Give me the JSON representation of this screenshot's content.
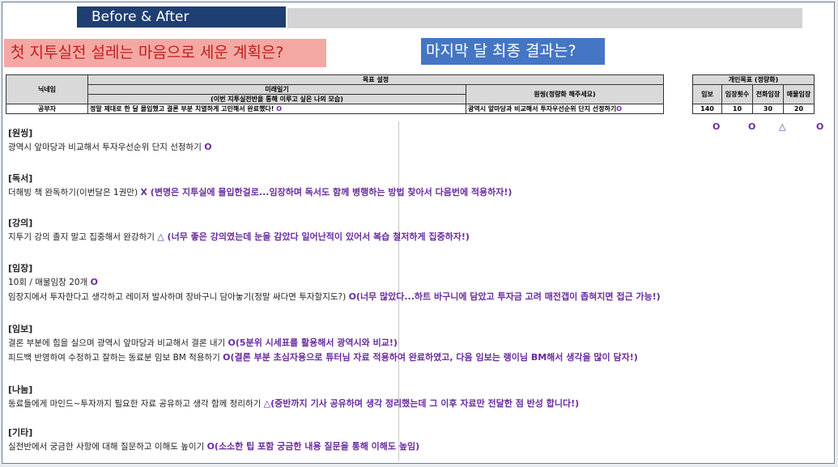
{
  "header": {
    "title": "Before & After"
  },
  "questions": {
    "plan": "첫 지투실전 설레는 마음으로 세운 계획은?",
    "result": "마지막 달 최종 결과는?"
  },
  "table": {
    "col_nickname": "닉네임",
    "col_goal": "목표 설정",
    "col_future_diary_l1": "미래일기",
    "col_future_diary_l2": "(이번 지투실전반을 통해 이루고 싶은 나의 모습)",
    "col_wish": "원씽(정량화 해주세요)",
    "col_personal": "개인목표 (정량화)",
    "sub_cols": [
      "임보",
      "임장횟수",
      "전화임장",
      "매물임장"
    ],
    "row": {
      "nickname": "공부자",
      "future_diary": "정말 제대로 한 달 몰입했고 결론 부분 치열하게 고민해서 완료했다!",
      "future_mark": "O",
      "wish": "광역시 앞마당과 비교해서 투자우선순위 단지 선정하기",
      "wish_mark": "O",
      "values": [
        "140",
        "10",
        "30",
        "20"
      ]
    },
    "result_marks": [
      "O",
      "O",
      "△",
      "O"
    ]
  },
  "sections": [
    {
      "title": "[원씽]",
      "lines": [
        {
          "text": "광역시 앞마당과 비교해서 투자우선순위 단지 선정하기",
          "note": "O"
        }
      ]
    },
    {
      "title": "[독서]",
      "lines": [
        {
          "text": "더해빙 책 완독하기(이번달은 1권만)",
          "note": "X (변명은 지투실에 몰입한걸로...임장하며 독서도 함께 병행하는 방법 찾아서 다음번에 적용하자!)"
        }
      ]
    },
    {
      "title": "[강의]",
      "lines": [
        {
          "text": "지투기 강의 졸지 말고 집중해서 완강하기",
          "note": "△ (너무 좋은 강의였는데 눈을 감았다 일어난적이 있어서 복습 철저하게 집중하자!)"
        }
      ]
    },
    {
      "title": "[임장]",
      "lines": [
        {
          "text": "10회 / 매물임장 20개",
          "note": "O"
        },
        {
          "text": "임장지에서 투자한다고 생각하고 레이저 발사하며 장바구니 담아놓기(정말 싸다면 투자할지도?)",
          "note": "O(너무 많았다...하트 바구니에 담았고 투자금 고려 매전갭이 좁혀지면 접근 가능!)"
        }
      ]
    },
    {
      "title": "[임보]",
      "lines": [
        {
          "text": "결론 부분에 힘을 실으며 광역시 앞마당과 비교해서 결론 내기",
          "note": "O(5분위 시세표를 활용해서 광역시와 비교!)"
        },
        {
          "text": "피드백 반영하여 수정하고 잘하는 동료분 임보 BM 적용하기",
          "note": "O(결론 부분 초심자용으로 튜터님 자료 적용하여 완료하였고, 다음 임보는 랭이님 BM해서 생각을 많이 담자!)"
        }
      ]
    },
    {
      "title": "[나눔]",
      "lines": [
        {
          "text": "동료들에게 마인드~투자까지 필요한 자료 공유하고 생각 함께 정리하기",
          "note": "△(중반까지 기사 공유하며 생각 정리했는데 그 이후 자료만 전달한 점 반성 합니다!)"
        }
      ]
    },
    {
      "title": "[기타]",
      "lines": [
        {
          "text": "실전반에서 궁금한 사항에 대해 질문하고 이해도 높이기",
          "note": "O(소소한 팁 포함 궁금한 내용 질문을 통해 이해도 높임)"
        }
      ]
    }
  ],
  "colors": {
    "header": "#1f3e72",
    "plan_bg": "#f4a8a4",
    "plan_text": "#c0201a",
    "result_bg": "#4476c4",
    "note": "#6a2ba0"
  }
}
